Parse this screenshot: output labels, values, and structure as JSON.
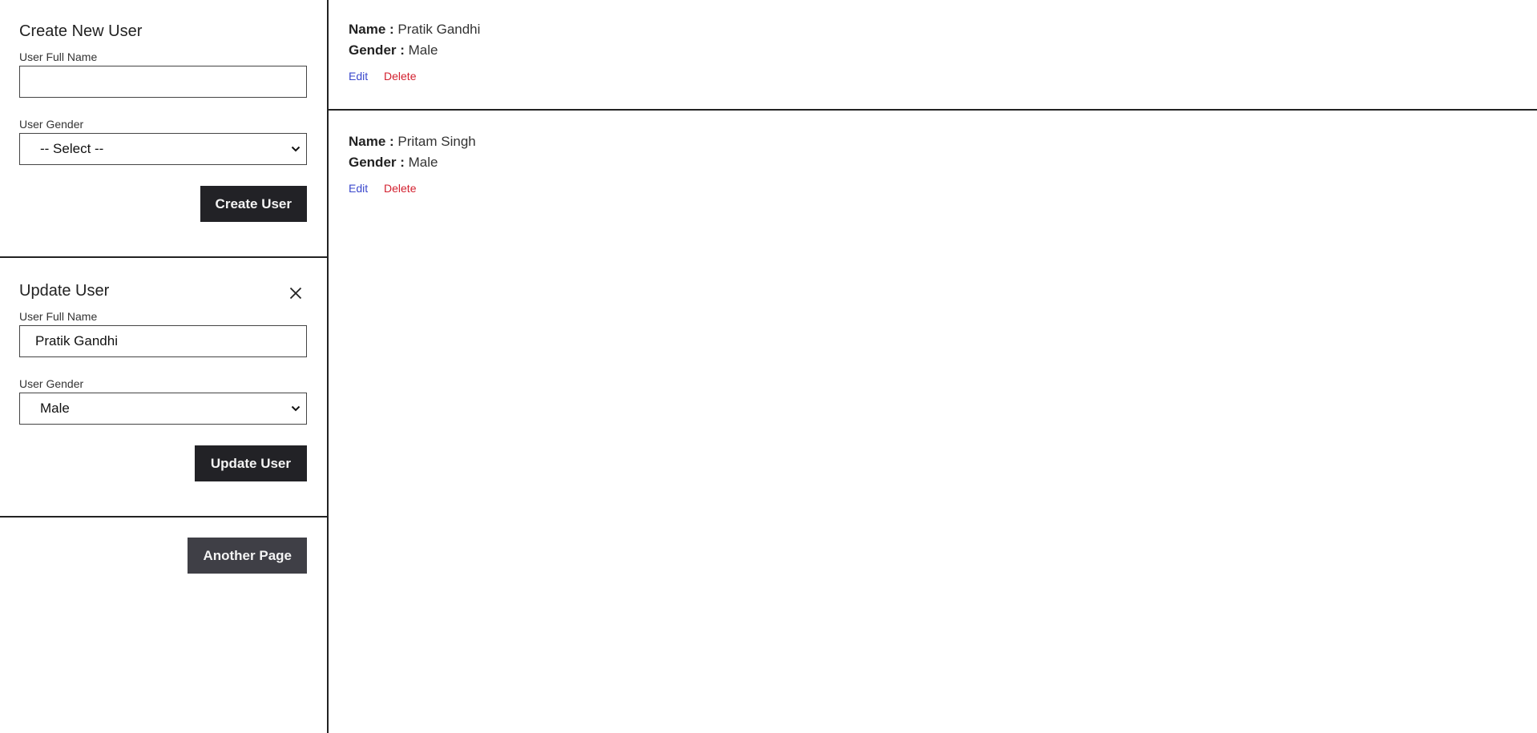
{
  "create_panel": {
    "title": "Create New User",
    "name_label": "User Full Name",
    "name_value": "",
    "name_placeholder": "",
    "gender_label": "User Gender",
    "gender_selected": "-- Select --",
    "submit_label": "Create User"
  },
  "update_panel": {
    "title": "Update User",
    "close_icon": "close-icon",
    "name_label": "User Full Name",
    "name_value": "Pratik Gandhi",
    "gender_label": "User Gender",
    "gender_selected": "Male",
    "submit_label": "Update User"
  },
  "nav": {
    "another_page_label": "Another Page"
  },
  "users": [
    {
      "name_key": "Name :",
      "name": "Pratik Gandhi",
      "gender_key": "Gender :",
      "gender": "Male",
      "edit_label": "Edit",
      "delete_label": "Delete"
    },
    {
      "name_key": "Name :",
      "name": "Pritam Singh",
      "gender_key": "Gender :",
      "gender": "Male",
      "edit_label": "Edit",
      "delete_label": "Delete"
    }
  ],
  "colors": {
    "button_dark": "#222226",
    "button_secondary": "#3f3f46",
    "edit_link": "#3b48cc",
    "delete_link": "#d3202f",
    "divider": "#222222"
  }
}
